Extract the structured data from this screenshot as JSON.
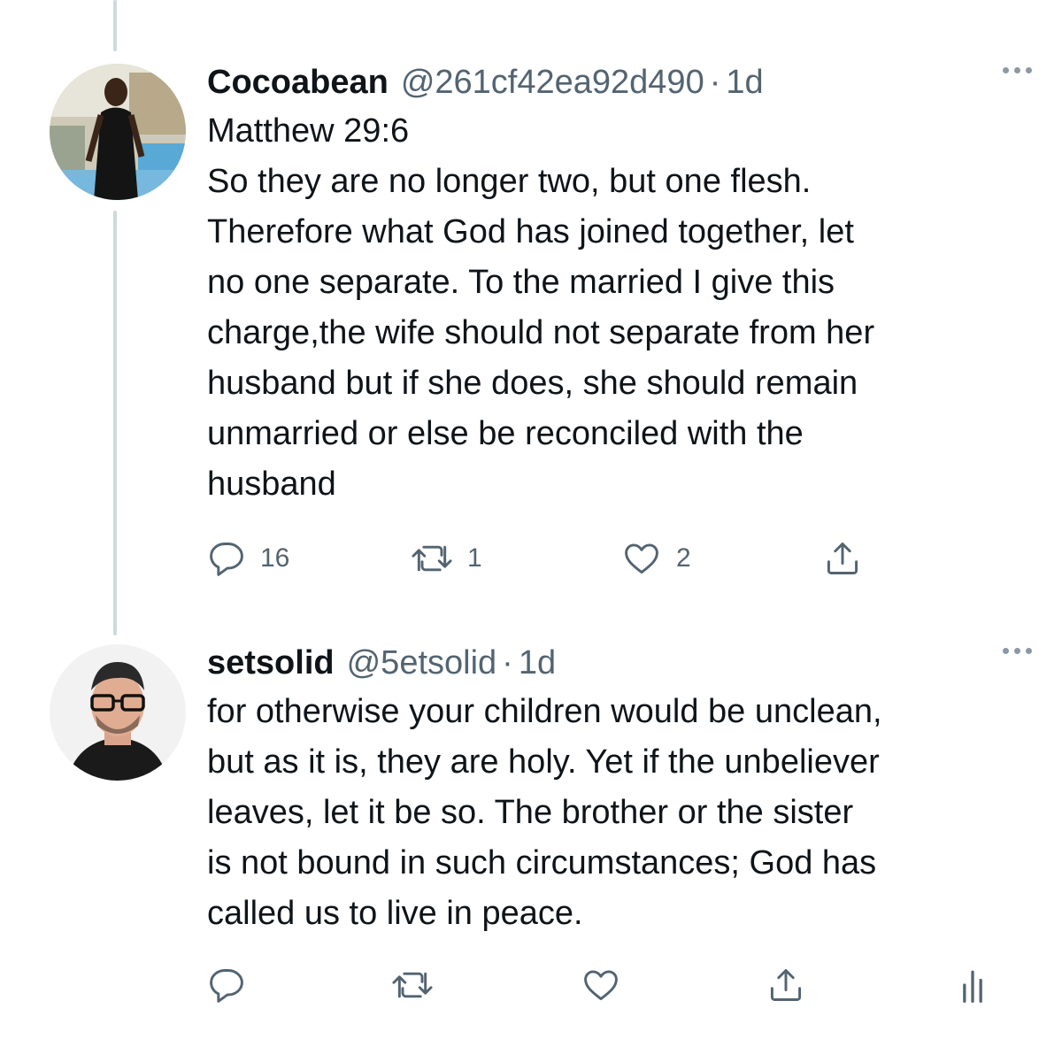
{
  "tweets": [
    {
      "name": "Cocoabean",
      "handle": "@261cf42ea92d490",
      "separator": "·",
      "time": "1d",
      "lines": [
        "Matthew 29:6",
        "So they are no longer two, but one flesh.",
        "Therefore what God has joined together, let",
        "no one separate. To the married I give this",
        "charge,the wife should not separate from her",
        "husband but if she does, she should remain",
        "unmarried or else be reconciled with the",
        "husband"
      ],
      "reply_count": "16",
      "retweet_count": "1",
      "like_count": "2"
    },
    {
      "name": "setsolid",
      "handle": "@5etsolid",
      "separator": "·",
      "time": "1d",
      "lines": [
        "for otherwise your children would be unclean,",
        "but as it is, they are holy. Yet if the unbeliever",
        "leaves, let it be so. The brother or the sister",
        "is not bound in such circumstances; God has",
        "called us to live in peace."
      ]
    }
  ],
  "icons": {
    "reply": "reply-icon",
    "retweet": "retweet-icon",
    "like": "like-icon",
    "share": "share-icon",
    "analytics": "analytics-icon",
    "more": "more-icon"
  },
  "colors": {
    "text": "#0f1419",
    "muted": "#536471",
    "thread_line": "#cfd9de"
  }
}
